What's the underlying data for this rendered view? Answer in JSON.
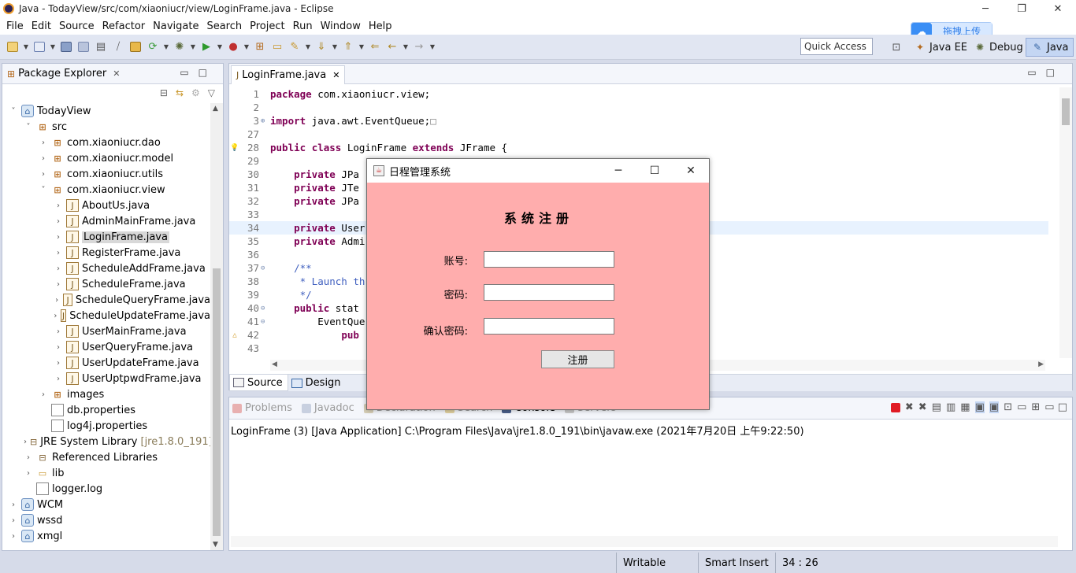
{
  "window": {
    "title": "Java - TodayView/src/com/xiaoniucr/view/LoginFrame.java - Eclipse",
    "minimize": "─",
    "maximize": "❐",
    "close": "✕"
  },
  "menu": [
    "File",
    "Edit",
    "Source",
    "Refactor",
    "Navigate",
    "Search",
    "Project",
    "Run",
    "Window",
    "Help"
  ],
  "cloud_widget": {
    "label": "拖拽上传",
    "icon": "cloud-icon"
  },
  "quick_access": {
    "placeholder": "Quick Access"
  },
  "perspectives": [
    {
      "label": "Java EE",
      "icon": "java-ee-perspective-icon"
    },
    {
      "label": "Debug",
      "icon": "debug-perspective-icon"
    },
    {
      "label": "Java",
      "icon": "java-perspective-icon",
      "active": true
    }
  ],
  "package_explorer": {
    "title": "Package Explorer",
    "tree": [
      {
        "label": "TodayView",
        "depth": 0,
        "twisty": "˅",
        "icon": "project"
      },
      {
        "label": "src",
        "depth": 1,
        "twisty": "˅",
        "icon": "source-folder"
      },
      {
        "label": "com.xiaoniucr.dao",
        "depth": 2,
        "twisty": "›",
        "icon": "package"
      },
      {
        "label": "com.xiaoniucr.model",
        "depth": 2,
        "twisty": "›",
        "icon": "package"
      },
      {
        "label": "com.xiaoniucr.utils",
        "depth": 2,
        "twisty": "›",
        "icon": "package"
      },
      {
        "label": "com.xiaoniucr.view",
        "depth": 2,
        "twisty": "˅",
        "icon": "package"
      },
      {
        "label": "AboutUs.java",
        "depth": 3,
        "twisty": "›",
        "icon": "java-file"
      },
      {
        "label": "AdminMainFrame.java",
        "depth": 3,
        "twisty": "›",
        "icon": "java-file"
      },
      {
        "label": "LoginFrame.java",
        "depth": 3,
        "twisty": "›",
        "icon": "java-file",
        "selected": true
      },
      {
        "label": "RegisterFrame.java",
        "depth": 3,
        "twisty": "›",
        "icon": "java-file"
      },
      {
        "label": "ScheduleAddFrame.java",
        "depth": 3,
        "twisty": "›",
        "icon": "java-file"
      },
      {
        "label": "ScheduleFrame.java",
        "depth": 3,
        "twisty": "›",
        "icon": "java-file"
      },
      {
        "label": "ScheduleQueryFrame.java",
        "depth": 3,
        "twisty": "›",
        "icon": "java-file"
      },
      {
        "label": "ScheduleUpdateFrame.java",
        "depth": 3,
        "twisty": "›",
        "icon": "java-file"
      },
      {
        "label": "UserMainFrame.java",
        "depth": 3,
        "twisty": "›",
        "icon": "java-file"
      },
      {
        "label": "UserQueryFrame.java",
        "depth": 3,
        "twisty": "›",
        "icon": "java-file"
      },
      {
        "label": "UserUpdateFrame.java",
        "depth": 3,
        "twisty": "›",
        "icon": "java-file"
      },
      {
        "label": "UserUptpwdFrame.java",
        "depth": 3,
        "twisty": "›",
        "icon": "java-file"
      },
      {
        "label": "images",
        "depth": 2,
        "twisty": "›",
        "icon": "package-folder"
      },
      {
        "label": "db.properties",
        "depth": 2,
        "twisty": "",
        "icon": "file"
      },
      {
        "label": "log4j.properties",
        "depth": 2,
        "twisty": "",
        "icon": "file"
      },
      {
        "label": "JRE System Library",
        "suffix": "[jre1.8.0_191]",
        "depth": 1,
        "twisty": "›",
        "icon": "library"
      },
      {
        "label": "Referenced Libraries",
        "depth": 1,
        "twisty": "›",
        "icon": "library"
      },
      {
        "label": "lib",
        "depth": 1,
        "twisty": "›",
        "icon": "folder"
      },
      {
        "label": "logger.log",
        "depth": 1,
        "twisty": "",
        "icon": "file"
      },
      {
        "label": "WCM",
        "depth": 0,
        "twisty": "›",
        "icon": "project"
      },
      {
        "label": "wssd",
        "depth": 0,
        "twisty": "›",
        "icon": "project"
      },
      {
        "label": "xmgl",
        "depth": 0,
        "twisty": "›",
        "icon": "project"
      }
    ]
  },
  "editor": {
    "tab_label": "LoginFrame.java",
    "lines": [
      {
        "n": "1",
        "text": "package com.xiaoniucr.view;",
        "kw": "package"
      },
      {
        "n": "2",
        "text": ""
      },
      {
        "n": "3",
        "text": "import java.awt.EventQueue;",
        "kw": "import",
        "fold": "⊕",
        "suffix": "□"
      },
      {
        "n": "27",
        "text": ""
      },
      {
        "n": "28",
        "text": "public class LoginFrame extends JFrame {",
        "kw": "public class",
        "mark": "💡"
      },
      {
        "n": "29",
        "text": ""
      },
      {
        "n": "30",
        "text": "    private JPa",
        "kw": "private"
      },
      {
        "n": "31",
        "text": "    private JTe",
        "kw": "private"
      },
      {
        "n": "32",
        "text": "    private JPa",
        "kw": "private"
      },
      {
        "n": "33",
        "text": ""
      },
      {
        "n": "34",
        "text": "    private User",
        "kw": "private",
        "current": true
      },
      {
        "n": "35",
        "text": "    private Admi",
        "kw": "private"
      },
      {
        "n": "36",
        "text": ""
      },
      {
        "n": "37",
        "text": "    /**",
        "comment": true,
        "fold": "⊖"
      },
      {
        "n": "38",
        "text": "     * Launch th",
        "comment": true
      },
      {
        "n": "39",
        "text": "     */",
        "comment": true
      },
      {
        "n": "40",
        "text": "    public stat",
        "kw": "public",
        "fold": "⊖"
      },
      {
        "n": "41",
        "text": "        EventQue",
        "fold": "⊖"
      },
      {
        "n": "42",
        "text": "            pub",
        "kw": "pub",
        "mark": "△"
      },
      {
        "n": "43",
        "text": ""
      }
    ],
    "bottom_tabs": [
      {
        "label": "Source",
        "active": true
      },
      {
        "label": "Design",
        "active": false
      }
    ]
  },
  "console": {
    "tabs": [
      "Problems",
      "Javadoc",
      "Declaration",
      "Search",
      "Console",
      "Servers"
    ],
    "launch_line": "LoginFrame (3) [Java Application] C:\\Program Files\\Java\\jre1.8.0_191\\bin\\javaw.exe (2021年7月20日 上午9:22:50)"
  },
  "status": {
    "writable": "Writable",
    "insert_mode": "Smart Insert",
    "position": "34 : 26"
  },
  "dialog": {
    "title": "日程管理系统",
    "heading": "系统注册",
    "fields": [
      {
        "label": "账号:",
        "value": ""
      },
      {
        "label": "密码:",
        "value": ""
      },
      {
        "label": "确认密码:",
        "value": ""
      }
    ],
    "submit_label": "注册",
    "background": "#ffadad"
  }
}
